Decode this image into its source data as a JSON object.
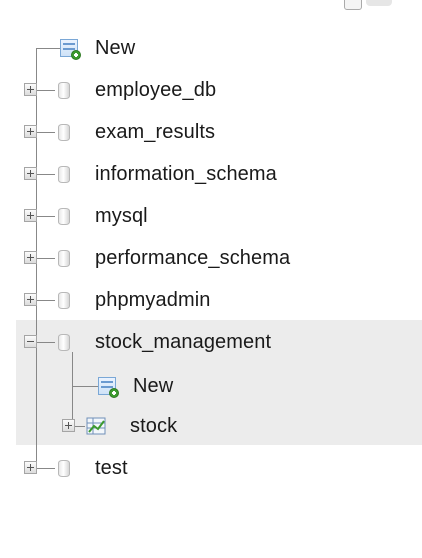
{
  "navigation_tree": {
    "new_label": "New",
    "databases": [
      "employee_db",
      "exam_results",
      "information_schema",
      "mysql",
      "performance_schema",
      "phpmyadmin",
      "stock_management",
      "test"
    ],
    "expanded_db": {
      "name": "stock_management",
      "children": {
        "new_label": "New",
        "table": "stock"
      }
    }
  }
}
